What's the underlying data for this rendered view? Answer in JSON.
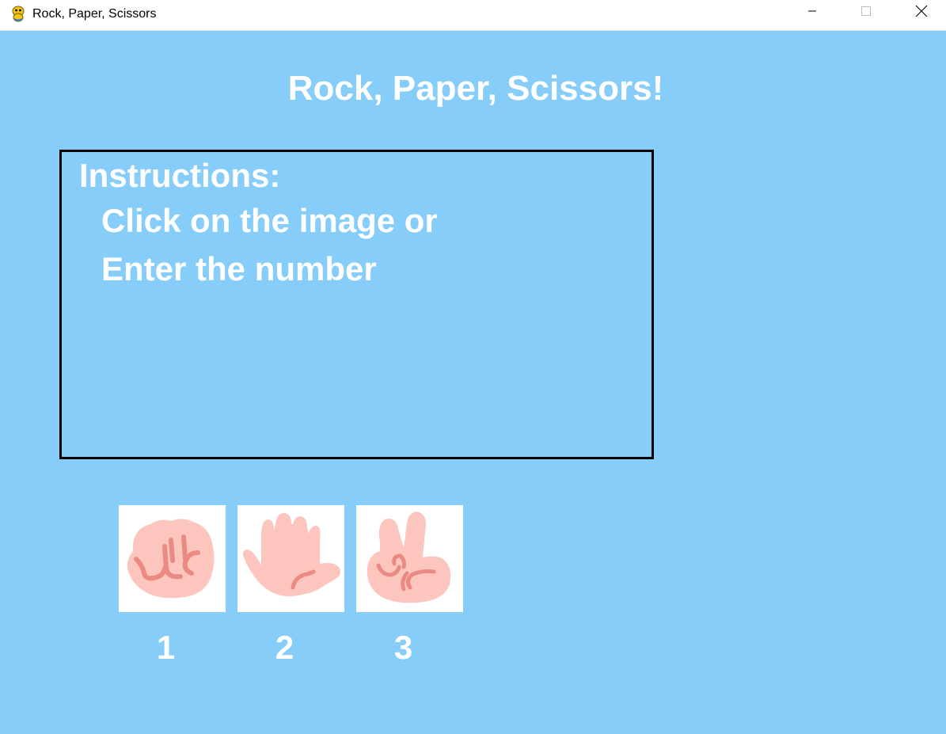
{
  "window": {
    "title": "Rock, Paper, Scissors",
    "icon": "pygame-snake-icon",
    "controls": {
      "minimize": "minimize-icon",
      "maximize": "maximize-icon",
      "close": "close-icon"
    }
  },
  "game": {
    "title": "Rock, Paper, Scissors!",
    "background_color": "#87CDF9",
    "instructions": {
      "heading": "Instructions:",
      "lines": [
        "Click on the image or",
        "Enter the number"
      ]
    },
    "choices": [
      {
        "name": "rock",
        "icon": "rock-hand-icon",
        "number": "1"
      },
      {
        "name": "paper",
        "icon": "paper-hand-icon",
        "number": "2"
      },
      {
        "name": "scissors",
        "icon": "scissors-hand-icon",
        "number": "3"
      }
    ]
  }
}
